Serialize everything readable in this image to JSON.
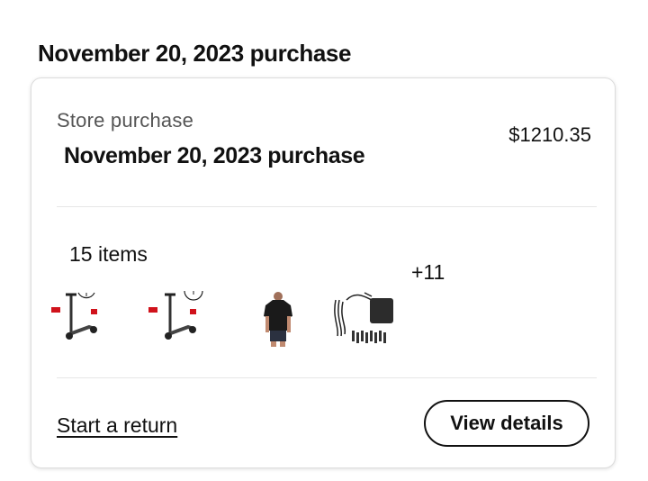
{
  "header": {
    "title": "November 20, 2023 purchase"
  },
  "order": {
    "store_label": "Store purchase",
    "title": "November 20, 2023 purchase",
    "amount": "$1210.35",
    "item_count": "15 items",
    "more_count": "+11",
    "thumbnails": [
      {
        "icon": "scooter-icon"
      },
      {
        "icon": "scooter-icon"
      },
      {
        "icon": "tshirt-icon"
      },
      {
        "icon": "charger-cable-icon"
      }
    ],
    "return_label": "Start a return",
    "details_label": "View details"
  },
  "colors": {
    "accent_red": "#d0121b",
    "text": "#111111",
    "muted": "#555555",
    "border": "#dcdcdc"
  }
}
